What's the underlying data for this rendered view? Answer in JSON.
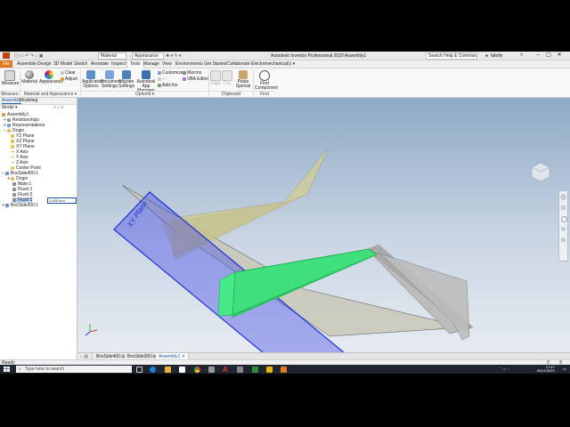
{
  "titlebar": {
    "material_dropdown": "Material",
    "appearance_dropdown": "Appearance",
    "title": "Autodesk Inventor Professional 2020   Assembly1",
    "search_placeholder": "Search Help & Commands...",
    "user": "fafolfy",
    "help": "?"
  },
  "tabs": [
    "File",
    "Assemble",
    "Design",
    "3D Model",
    "Sketch",
    "Annotate",
    "Inspect",
    "Tools",
    "Manage",
    "View",
    "Environments",
    "Get Started",
    "Collaborate",
    "Electromechanical"
  ],
  "active_tab": "Tools",
  "ribbon": {
    "measure": "Measure",
    "material": "Material",
    "appearance": "Appearance",
    "clear": "Clear",
    "adjust": "Adjust",
    "application_options": "Application Options",
    "document_settings": "Document Settings",
    "migrate_settings": "Migrate Settings",
    "app_manager": "Autodesk App Manager",
    "customize": "Customize",
    "macros": "Macros",
    "addins": "Add-Ins",
    "vba_editor": "VBA Editor",
    "copy": "Copy",
    "cut": "Cut",
    "paste_special": "Paste Special",
    "find_component": "Find Component",
    "group_measure": "Measure ▾",
    "group_material": "Material and Appearance ▾",
    "group_options": "Options ▾",
    "group_clipboard": "Clipboard",
    "group_find": "Find"
  },
  "browser": {
    "tab_assembly": "Assembly",
    "tab_modeling": "Modeling",
    "model_label": "Model",
    "items": [
      "Assembly1",
      "Relationships",
      "Representations",
      "Origin",
      "YZ Plane",
      "XZ Plane",
      "XY Plane",
      "X Axis",
      "Y Axis",
      "Z Axis",
      "Center Point",
      "BoxSide400:1",
      "Origin",
      "Mate:1",
      "Flush:1",
      "Flush:2",
      "Flush:3",
      "BoxSide300:1"
    ],
    "edit_value": "1.000 mm"
  },
  "viewport": {
    "plane_label": "XY Plane"
  },
  "doc_tabs": [
    "BoxSide400.ipt",
    "BoxSide300.ipt",
    "Assembly1"
  ],
  "active_doc_tab": "Assembly1",
  "status": {
    "text": "Ready",
    "count1": "2",
    "count2": "3"
  },
  "taskbar": {
    "search_placeholder": "Type here to search",
    "time": "17:47",
    "date": "06/11/2019"
  }
}
